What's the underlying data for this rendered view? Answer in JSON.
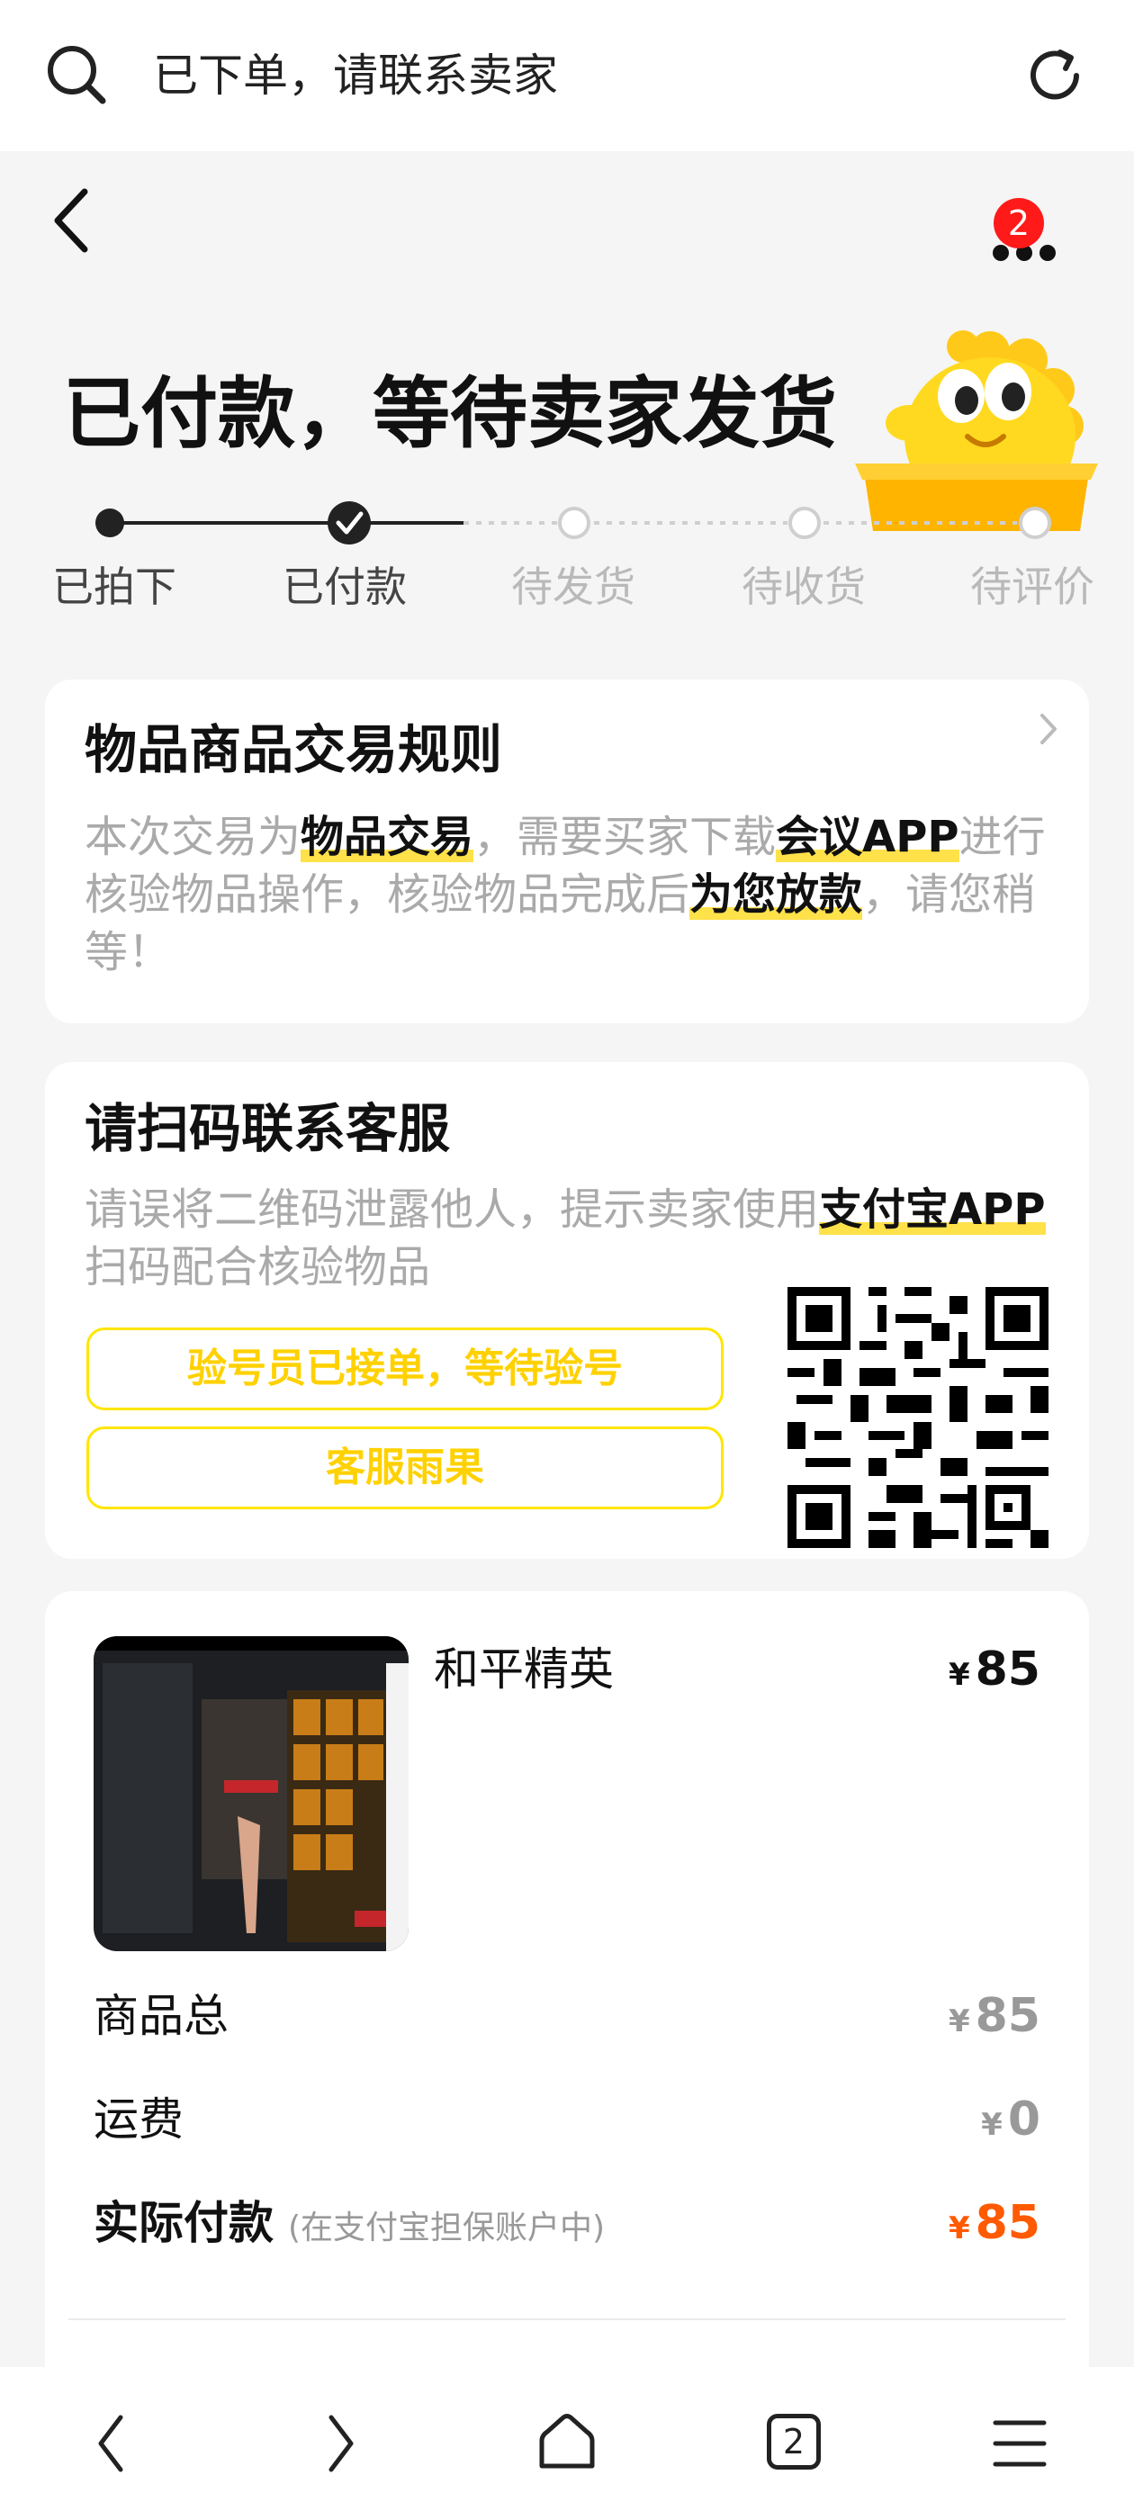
{
  "browser": {
    "search_text": "已下单，请联系卖家",
    "tab_count": "2"
  },
  "header": {
    "more_badge": "2",
    "title": "已付款，等待卖家发货"
  },
  "steps": [
    {
      "label": "已拍下",
      "state": "done"
    },
    {
      "label": "已付款",
      "state": "current"
    },
    {
      "label": "待发货",
      "state": "todo"
    },
    {
      "label": "待收货",
      "state": "todo"
    },
    {
      "label": "待评价",
      "state": "todo"
    }
  ],
  "rules_card": {
    "title": "物品商品交易规则",
    "text_1": "本次交易为",
    "hl_1": "物品交易",
    "text_2": "，需要买家下载",
    "hl_2": "会议APP",
    "text_3": "进行核验物品操作，核验物品完成后",
    "hl_3": "为您放款",
    "text_4": "，请您稍等！"
  },
  "service_card": {
    "title": "请扫码联系客服",
    "text_1": "请误将二维码泄露他人，提示卖家使用",
    "hl_1": "支付宝APP",
    "text_2": "扫码配合核验物品",
    "button_1": "验号员已接单，等待验号",
    "button_2": "客服雨果"
  },
  "order": {
    "product_name": "和平精英",
    "product_price": "85",
    "currency": "¥",
    "rows": [
      {
        "label": "商品总",
        "value": "85"
      },
      {
        "label": "运费",
        "value": "0"
      }
    ],
    "actual_label": "实际付款",
    "actual_note": "(在支付宝担保账户中)",
    "actual_value": "85"
  },
  "colors": {
    "accent_yellow": "#ffe600",
    "price_orange": "#ff5a00",
    "badge_red": "#ff1a1a"
  }
}
